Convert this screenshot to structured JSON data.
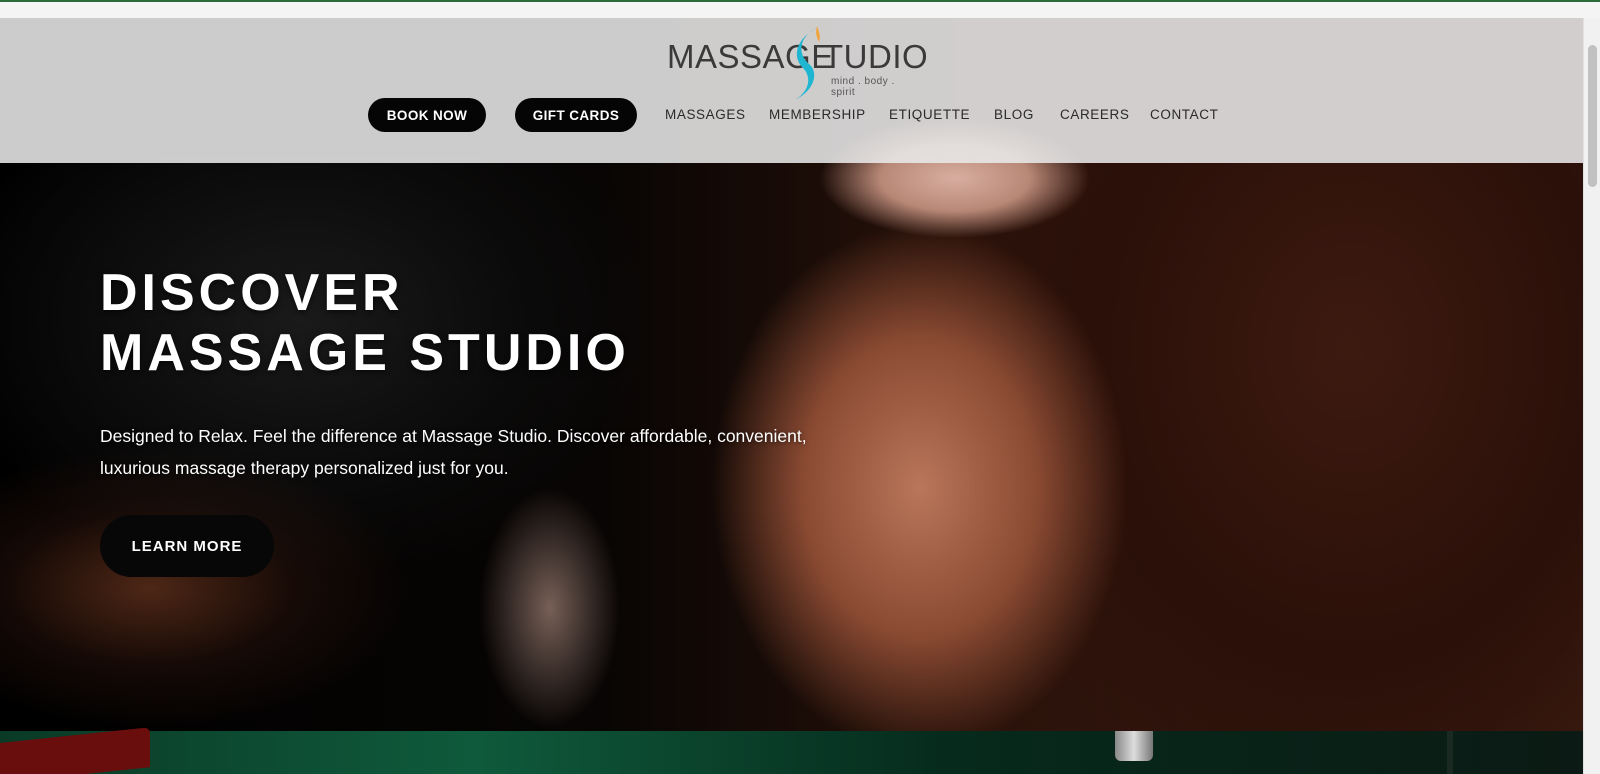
{
  "brand": {
    "name_part1": "MASSAGE",
    "name_part2": "TUDIO",
    "tagline": "mind . body . spirit",
    "colors": {
      "swoosh": "#1fb6d2",
      "accent_flame": "#f2a23a"
    }
  },
  "nav": {
    "book_now": "BOOK NOW",
    "gift_cards": "GIFT CARDS",
    "links": [
      "MASSAGES",
      "MEMBERSHIP",
      "ETIQUETTE",
      "BLOG",
      "CAREERS",
      "CONTACT"
    ]
  },
  "hero": {
    "title_line1": "DISCOVER",
    "title_line2": "MASSAGE STUDIO",
    "description": "Designed to Relax. Feel the difference at Massage Studio. Discover affordable, convenient, luxurious massage therapy personalized just for you.",
    "cta": "LEARN MORE"
  }
}
